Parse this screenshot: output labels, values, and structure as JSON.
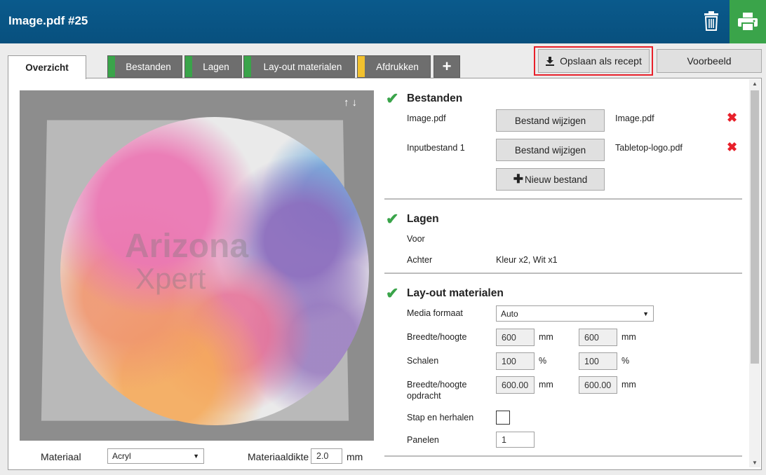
{
  "header": {
    "title": "Image.pdf #25",
    "trash_icon": "trash-icon",
    "print_icon": "print-icon"
  },
  "tabs": [
    {
      "label": "Overzicht",
      "active": true
    },
    {
      "label": "Bestanden",
      "color": "#3aa44a"
    },
    {
      "label": "Lagen",
      "color": "#3aa44a"
    },
    {
      "label": "Lay-out materialen",
      "color": "#3aa44a"
    },
    {
      "label": "Afdrukken",
      "color": "#f2c12e"
    },
    {
      "label": "+"
    }
  ],
  "actions": {
    "save_recipe": "Opslaan als recept",
    "preview": "Voorbeeld"
  },
  "preview": {
    "watermark_line1": "Arizona",
    "watermark_line2": "Xpert",
    "arrows": "↑↓"
  },
  "material": {
    "label": "Materiaal",
    "value": "Acryl",
    "thickness_label": "Materiaaldikte",
    "thickness_value": "2.0",
    "thickness_unit": "mm"
  },
  "bestanden": {
    "title": "Bestanden",
    "rows": [
      {
        "name": "Image.pdf",
        "button": "Bestand wijzigen",
        "file": "Image.pdf"
      },
      {
        "name": "Inputbestand 1",
        "button": "Bestand wijzigen",
        "file": "Tabletop-logo.pdf"
      }
    ],
    "new_file": "Nieuw bestand"
  },
  "lagen": {
    "title": "Lagen",
    "voor_label": "Voor",
    "achter_label": "Achter",
    "achter_value": "Kleur x2, Wit x1"
  },
  "layout": {
    "title": "Lay-out materialen",
    "media_label": "Media formaat",
    "media_value": "Auto",
    "size_label": "Breedte/hoogte",
    "width": "600",
    "height": "600",
    "unit_mm": "mm",
    "scale_label": "Schalen",
    "scale_x": "100",
    "scale_y": "100",
    "unit_pct": "%",
    "job_size_label_1": "Breedte/hoogte",
    "job_size_label_2": "opdracht",
    "job_width": "600.00",
    "job_height": "600.00",
    "step_label": "Stap en herhalen",
    "panels_label": "Panelen",
    "panels_value": "1"
  }
}
